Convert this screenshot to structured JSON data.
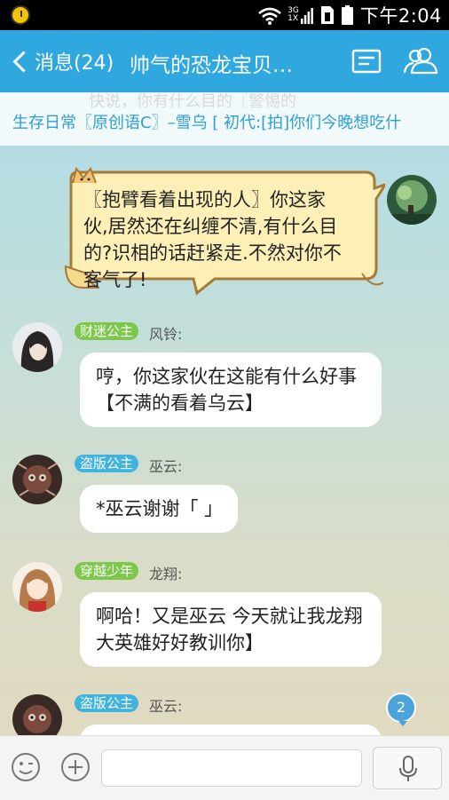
{
  "status_bar": {
    "network_type_top": "3G",
    "network_type_bottom": "1X",
    "time": "下午2:04",
    "icons": [
      "alarm-icon",
      "wifi-icon",
      "signal-icon",
      "sim-icon",
      "battery-icon"
    ]
  },
  "header": {
    "back_label": "消息(24)",
    "title": "帅气的恐龙宝贝…",
    "icons": [
      "group-notice-icon",
      "members-icon"
    ],
    "background": "#2fa7df"
  },
  "notice": {
    "faded_text": "快说，你有什么目的〖警惕的",
    "text": "生存日常〖原创语C〗–雪乌 [ 初代:[拍]你们今晚想吃什"
  },
  "messages": [
    {
      "side": "right",
      "text": "〖抱臂看着出现的人〗你这家伙,居然还在纠缠不清,有什么目的?识相的话赶紧走.不然对你不客气了!",
      "avatar": "forest-avatar"
    },
    {
      "side": "left",
      "badge": "财迷公主",
      "badge_color": "#7cc84a",
      "sender": "风铃:",
      "text": "哼，你这家伙在这能有什么好事【不满的看着乌云】",
      "avatar": "dark-hair-avatar"
    },
    {
      "side": "left",
      "badge": "盗版公主",
      "badge_color": "#3fb3e0",
      "sender": "巫云:",
      "text": "*巫云谢谢「 」",
      "avatar": "doll-avatar"
    },
    {
      "side": "left",
      "badge": "穿越少年",
      "badge_color": "#7cc84a",
      "sender": "龙翔:",
      "text": "啊哈！又是巫云 今天就让我龙翔大英雄好好教训你】",
      "avatar": "girl-avatar"
    },
    {
      "side": "left",
      "badge": "盗版公主",
      "badge_color": "#3fb3e0",
      "sender": "巫云:",
      "text": "",
      "avatar": "doll-avatar"
    }
  ],
  "new_message_count": "2",
  "input_bar": {
    "icons": [
      "emoji-icon",
      "plus-icon",
      "microphone-icon"
    ],
    "value": ""
  }
}
